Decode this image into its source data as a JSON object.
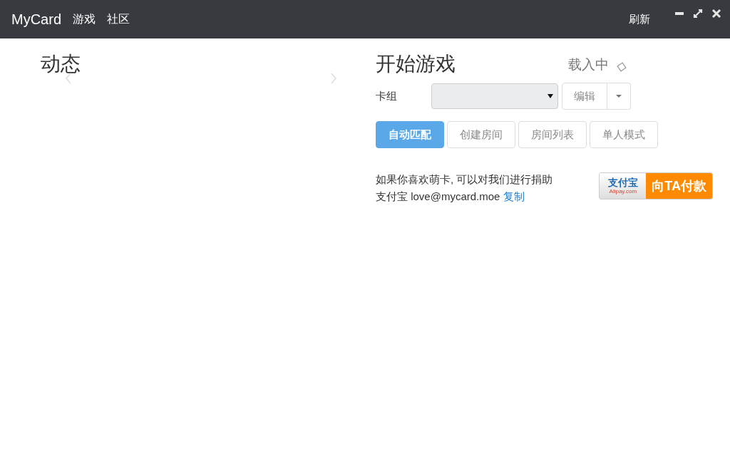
{
  "navbar": {
    "brand": "MyCard",
    "links": [
      {
        "label": "游戏"
      },
      {
        "label": "社区"
      }
    ],
    "refresh": "刷新"
  },
  "news": {
    "title": "动态"
  },
  "game": {
    "title": "开始游戏",
    "loading": "载入中",
    "deck_label": "卡组",
    "edit": "编辑",
    "modes": [
      {
        "label": "自动匹配",
        "selected": true
      },
      {
        "label": "创建房间",
        "selected": false
      },
      {
        "label": "房间列表",
        "selected": false
      },
      {
        "label": "单人模式",
        "selected": false
      }
    ]
  },
  "donate": {
    "line1": "如果你喜欢萌卡, 可以对我们进行捐助",
    "line2": "支付宝 love@mycard.moe",
    "copy": "复制",
    "logo_cn": "支付宝",
    "logo_en": "Alipay.com",
    "pay": "向TA付款"
  }
}
